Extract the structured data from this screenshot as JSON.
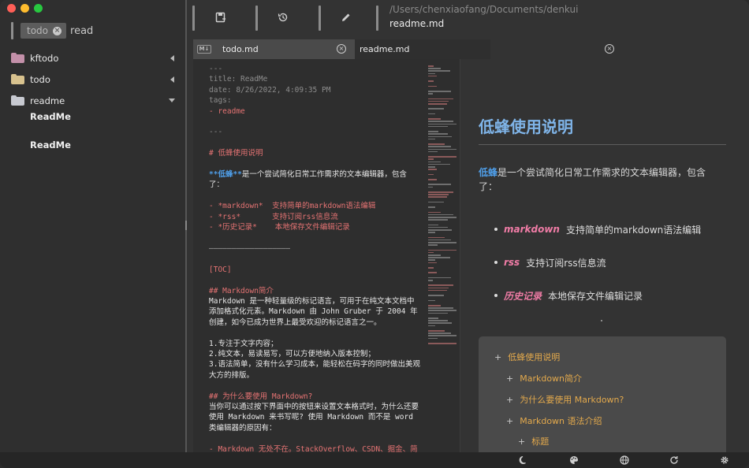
{
  "sidebar": {
    "tag_chip": "todo",
    "search_text": "read",
    "folders": [
      {
        "label": "kftodo"
      },
      {
        "label": "todo"
      },
      {
        "label": "readme"
      }
    ],
    "docs": [
      "ReadMe",
      "ReadMe"
    ]
  },
  "toolbar": {
    "path": "/Users/chenxiaofang/Documents/denkui",
    "file_title": "readme.md"
  },
  "tabs": [
    {
      "badge": "M↓",
      "label": "todo.md"
    },
    {
      "label": "readme.md"
    }
  ],
  "editor": {
    "lines": [
      "---",
      "title: ReadMe",
      "date: 8/26/2022, 4:09:35 PM",
      "tags:",
      "- readme",
      "",
      "---",
      "",
      "# 低蜂使用说明",
      "",
      "**低蜂**是一个尝试简化日常工作需求的文本编辑器，包含",
      "了：",
      "",
      "- *markdown*  支持简单的markdown语法编辑",
      "- *rss*       支持订阅rss信息流",
      "- *历史记录*    本地保存文件编辑记录",
      "",
      "——————————————————",
      "",
      "[TOC]",
      "",
      "## Markdown简介",
      "Markdown 是一种轻量级的标记语言，可用于在纯文本文档中",
      "添加格式化元素。Markdown 由 John Gruber 于 2004 年",
      "创建，如今已成为世界上最受欢迎的标记语言之一。",
      "",
      "1.专注于文字内容；",
      "2.纯文本，易读易写，可以方便地纳入版本控制；",
      "3.语法简单，没有什么学习成本，能轻松在码字的同时做出美观",
      "大方的排版。",
      "",
      "## 为什么要使用 Markdown?",
      "当你可以通过按下界面中的按钮来设置文本格式时，为什么还要",
      "使用 Markdown 来书写呢? 使用 Markdown 而不是 word",
      "类编辑器的原因有：",
      "",
      "- Markdown 无处不在。StackOverflow、CSDN、掘金、简"
    ]
  },
  "preview": {
    "h1": "低蜂使用说明",
    "para_highlight": "低蜂",
    "para_rest": "是一个尝试简化日常工作需求的文本编辑器，包含了：",
    "list": [
      {
        "em": "markdown",
        "text": "支持简单的markdown语法编辑"
      },
      {
        "em": "rss",
        "text": "支持订阅rss信息流"
      },
      {
        "em": "历史记录",
        "text": "本地保存文件编辑记录"
      }
    ],
    "toc": [
      {
        "label": "低蜂使用说明"
      },
      {
        "label": "Markdown简介"
      },
      {
        "label": "为什么要使用 Markdown?"
      },
      {
        "label": "Markdown 语法介绍"
      },
      {
        "label": "标题"
      }
    ]
  },
  "icons": {
    "toolbar": [
      "save-icon",
      "history-icon",
      "edit-icon"
    ],
    "bottombar": [
      "moon-icon",
      "palette-icon",
      "globe-icon",
      "refresh-icon",
      "gear-icon"
    ]
  },
  "colors": {
    "heading_blue": "#7fb4e8",
    "emphasis_pink": "#f07ca6",
    "toc_orange": "#e3a94c",
    "editor_red": "#e57373"
  }
}
